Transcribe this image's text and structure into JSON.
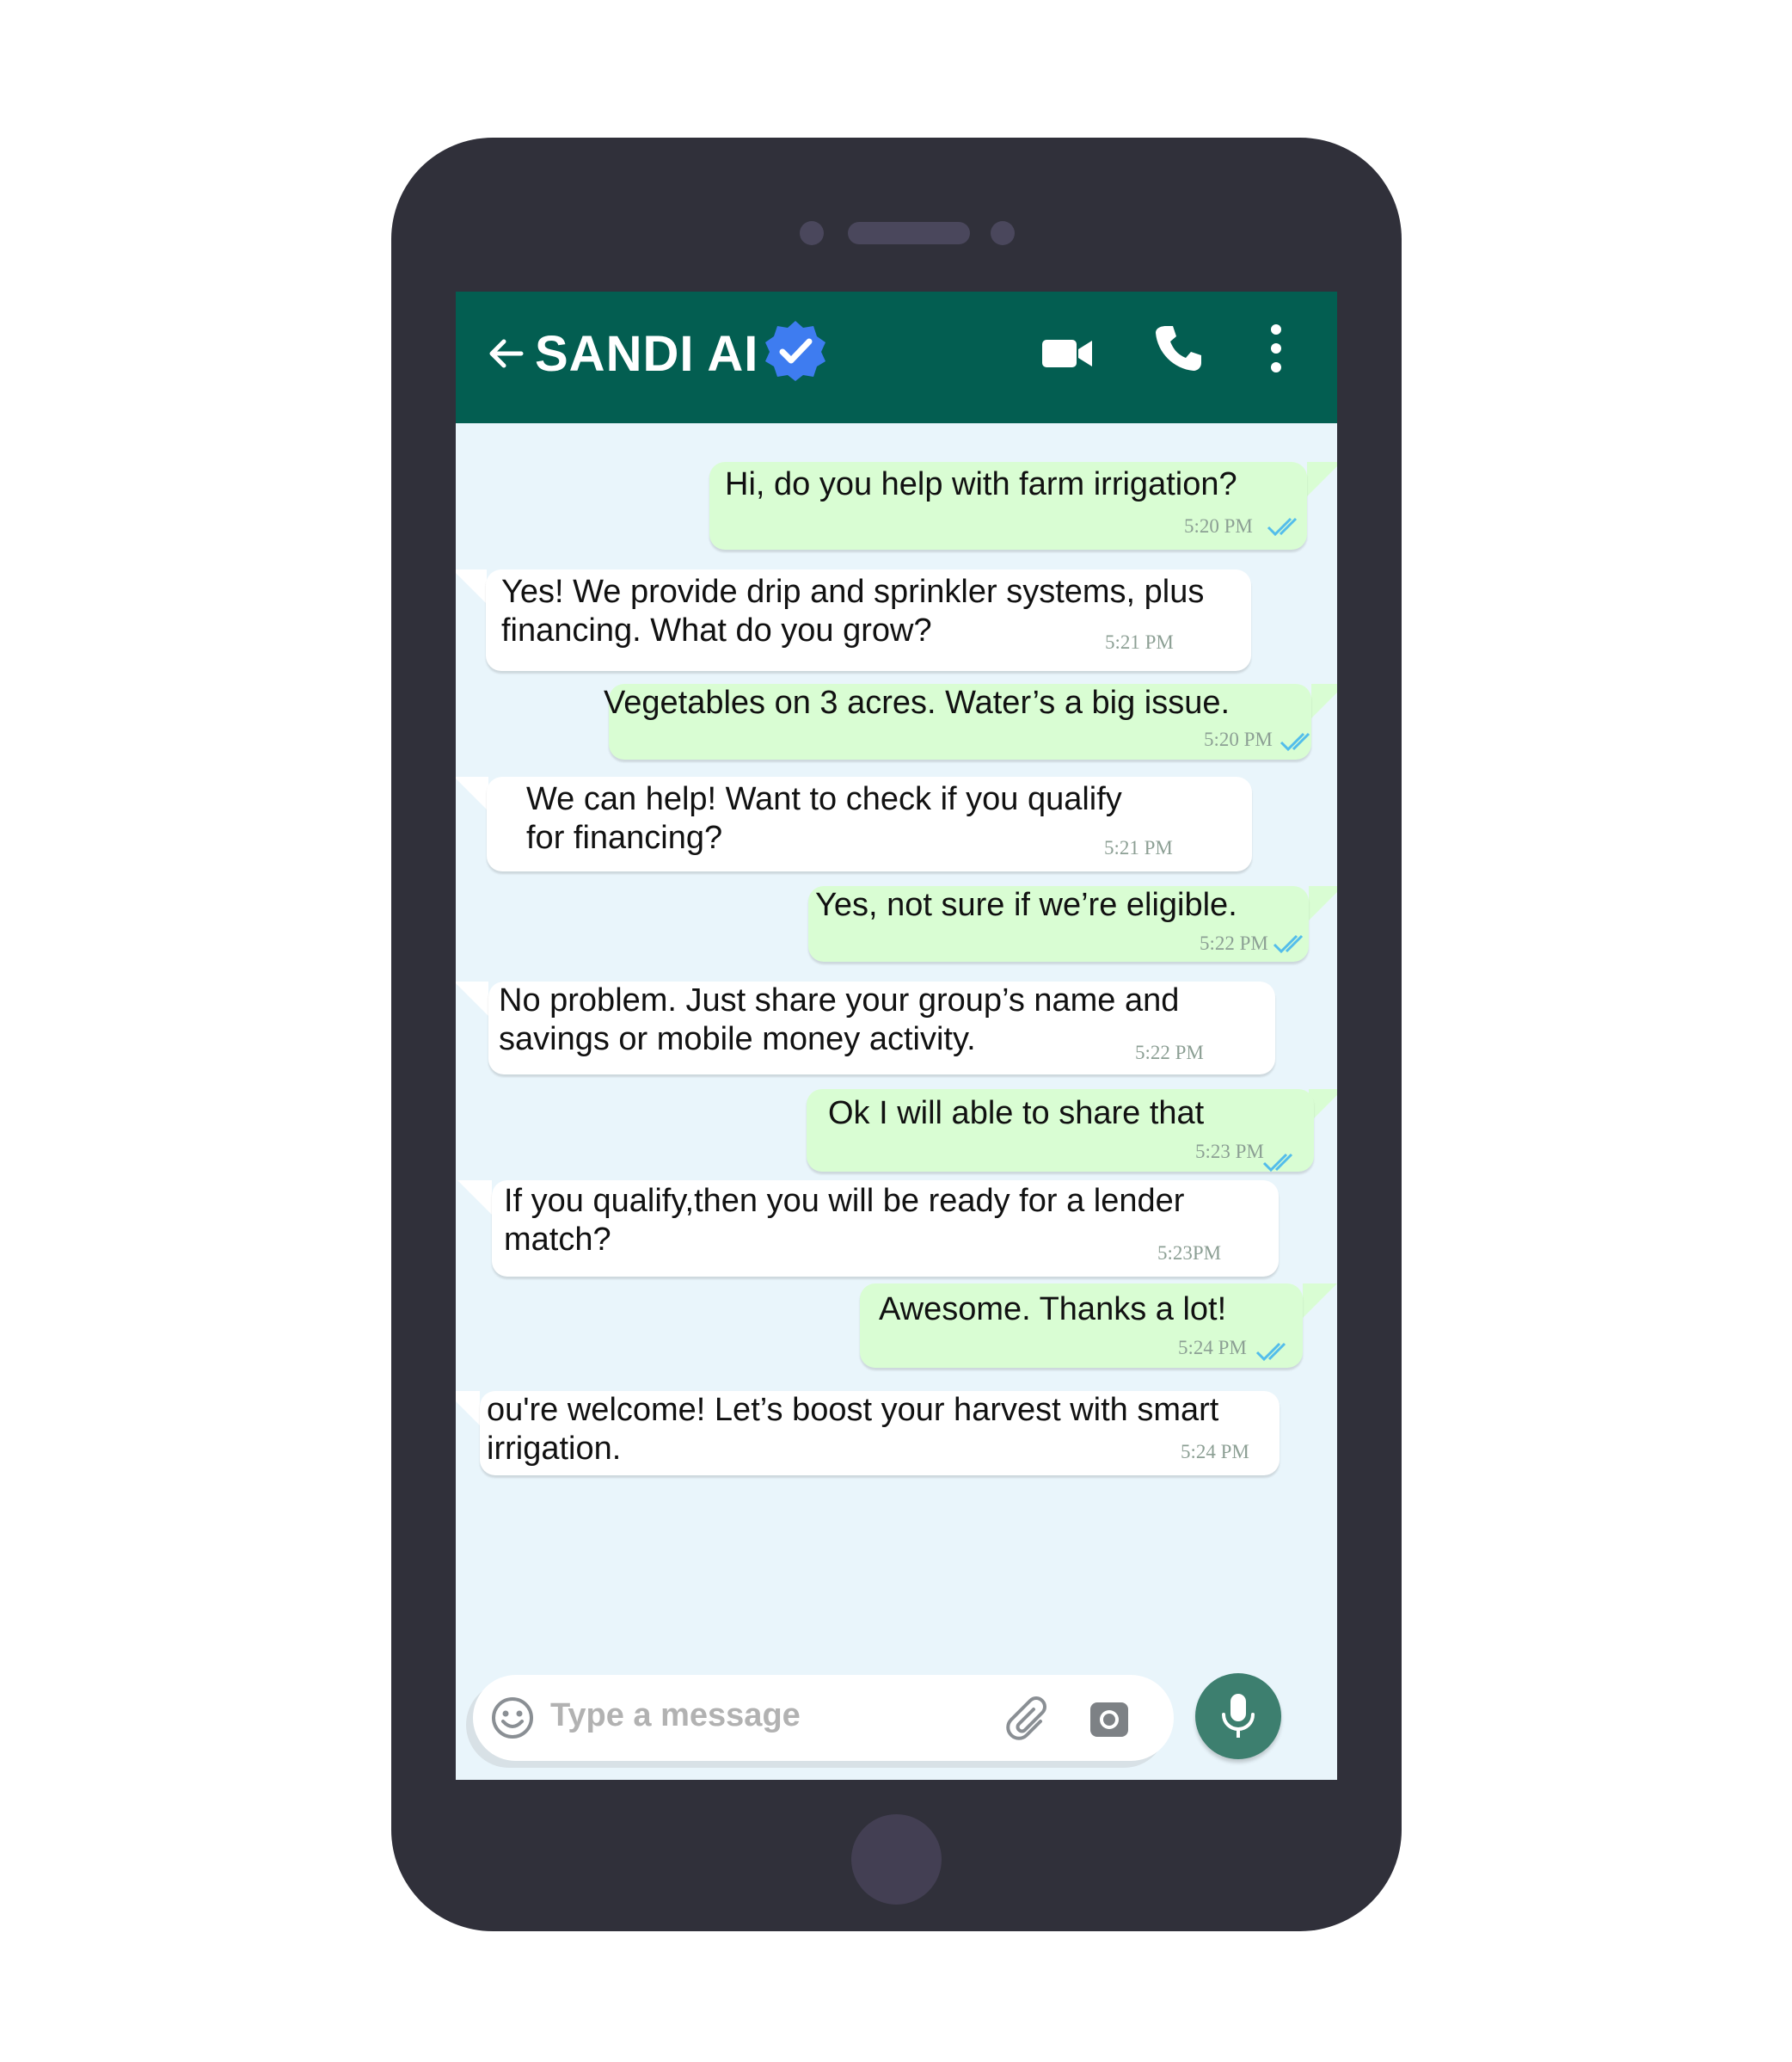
{
  "header": {
    "title": "SANDI AI"
  },
  "messages": [
    {
      "text": "Hi, do you help with farm irrigation?",
      "time": "5:20 PM"
    },
    {
      "text": "Yes! We provide drip and sprinkler systems, plus\nfinancing. What do you grow?",
      "time": "5:21 PM"
    },
    {
      "text": "Vegetables on 3 acres. Water’s a big issue.",
      "time": "5:20 PM"
    },
    {
      "text": "We can help! Want to check if you qualify\nfor financing?",
      "time": "5:21 PM"
    },
    {
      "text": "Yes, not sure if we’re eligible.",
      "time": "5:22 PM"
    },
    {
      "text": "No problem. Just share your group’s name and\nsavings or mobile money activity.",
      "time": "5:22 PM"
    },
    {
      "text": "Ok I will able to share that",
      "time": "5:23 PM"
    },
    {
      "text": "If you qualify,then you will be ready for a lender\nmatch?",
      "time": "5:23PM"
    },
    {
      "text": "Awesome. Thanks a lot!",
      "time": "5:24 PM"
    },
    {
      "text": "ou're welcome! Let’s boost your harvest with smart\nirrigation.",
      "time": "5:24 PM"
    }
  ],
  "composer": {
    "placeholder": "Type a message"
  },
  "colors": {
    "header": "#035e51",
    "chat_background": "#e9f5fb",
    "outgoing_bubble": "#d9fdd3",
    "incoming_bubble": "#ffffff",
    "read_ticks": "#53bdeb",
    "mic_button": "#3d7f6f",
    "verified_badge": "#3e7cf0",
    "phone_body": "#30303a"
  },
  "icons": [
    "back-arrow-icon",
    "verified-badge-icon",
    "video-call-icon",
    "phone-call-icon",
    "more-options-icon",
    "emoji-icon",
    "attach-icon",
    "camera-icon",
    "mic-icon",
    "double-check-icon"
  ]
}
